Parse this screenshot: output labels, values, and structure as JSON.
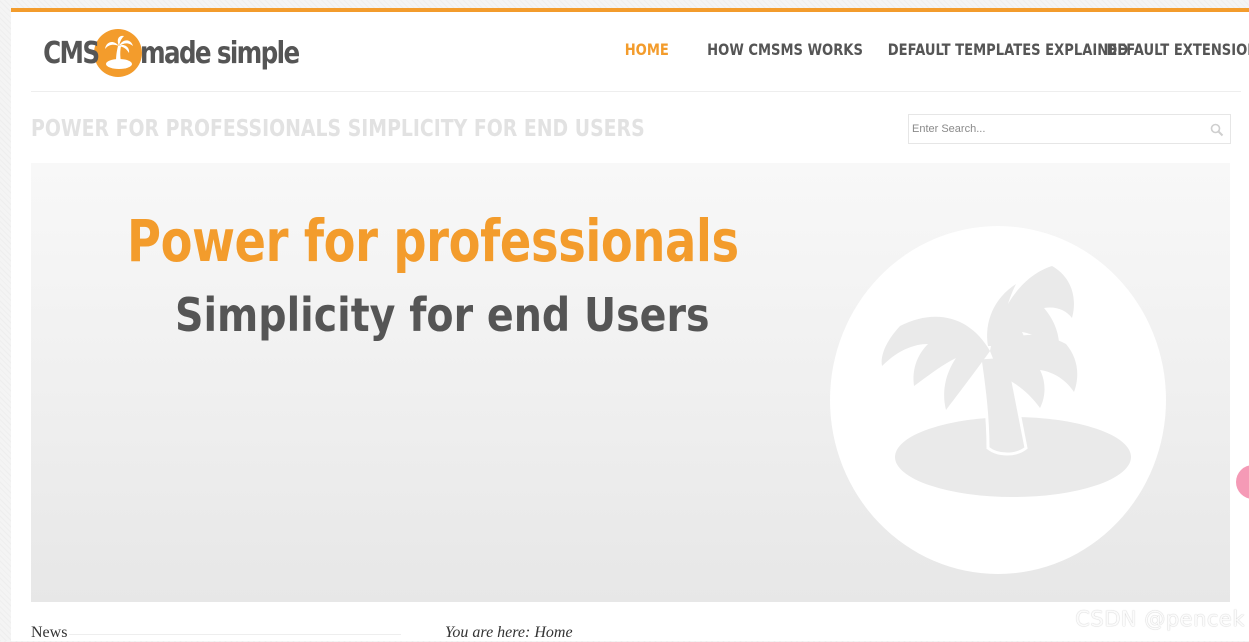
{
  "logo": {
    "left_text": "CMS",
    "right_text": "made simple",
    "accent_color": "#f39c2c"
  },
  "nav": {
    "items": [
      {
        "label": "Home",
        "active": true
      },
      {
        "label": "How CMSMS Works",
        "active": false
      },
      {
        "label": "Default Templates Explained",
        "active": false
      },
      {
        "label": "Default Extensions",
        "active": false
      }
    ]
  },
  "header": {
    "tagline": "Power for professionals Simplicity for end users"
  },
  "search": {
    "placeholder": "Enter Search...",
    "icon": "search-icon"
  },
  "banner": {
    "heading": "Power for professionals",
    "subheading": "Simplicity for end Users",
    "art": "palm-island-icon"
  },
  "sidebar": {
    "news_title": "News"
  },
  "breadcrumb": {
    "prefix": "You are here:",
    "current": "Home"
  },
  "watermark": {
    "text": "CSDN @pencek"
  },
  "colors": {
    "accent": "#f39c2c",
    "text_dark": "#555555",
    "tagline": "#e2e2e2"
  }
}
